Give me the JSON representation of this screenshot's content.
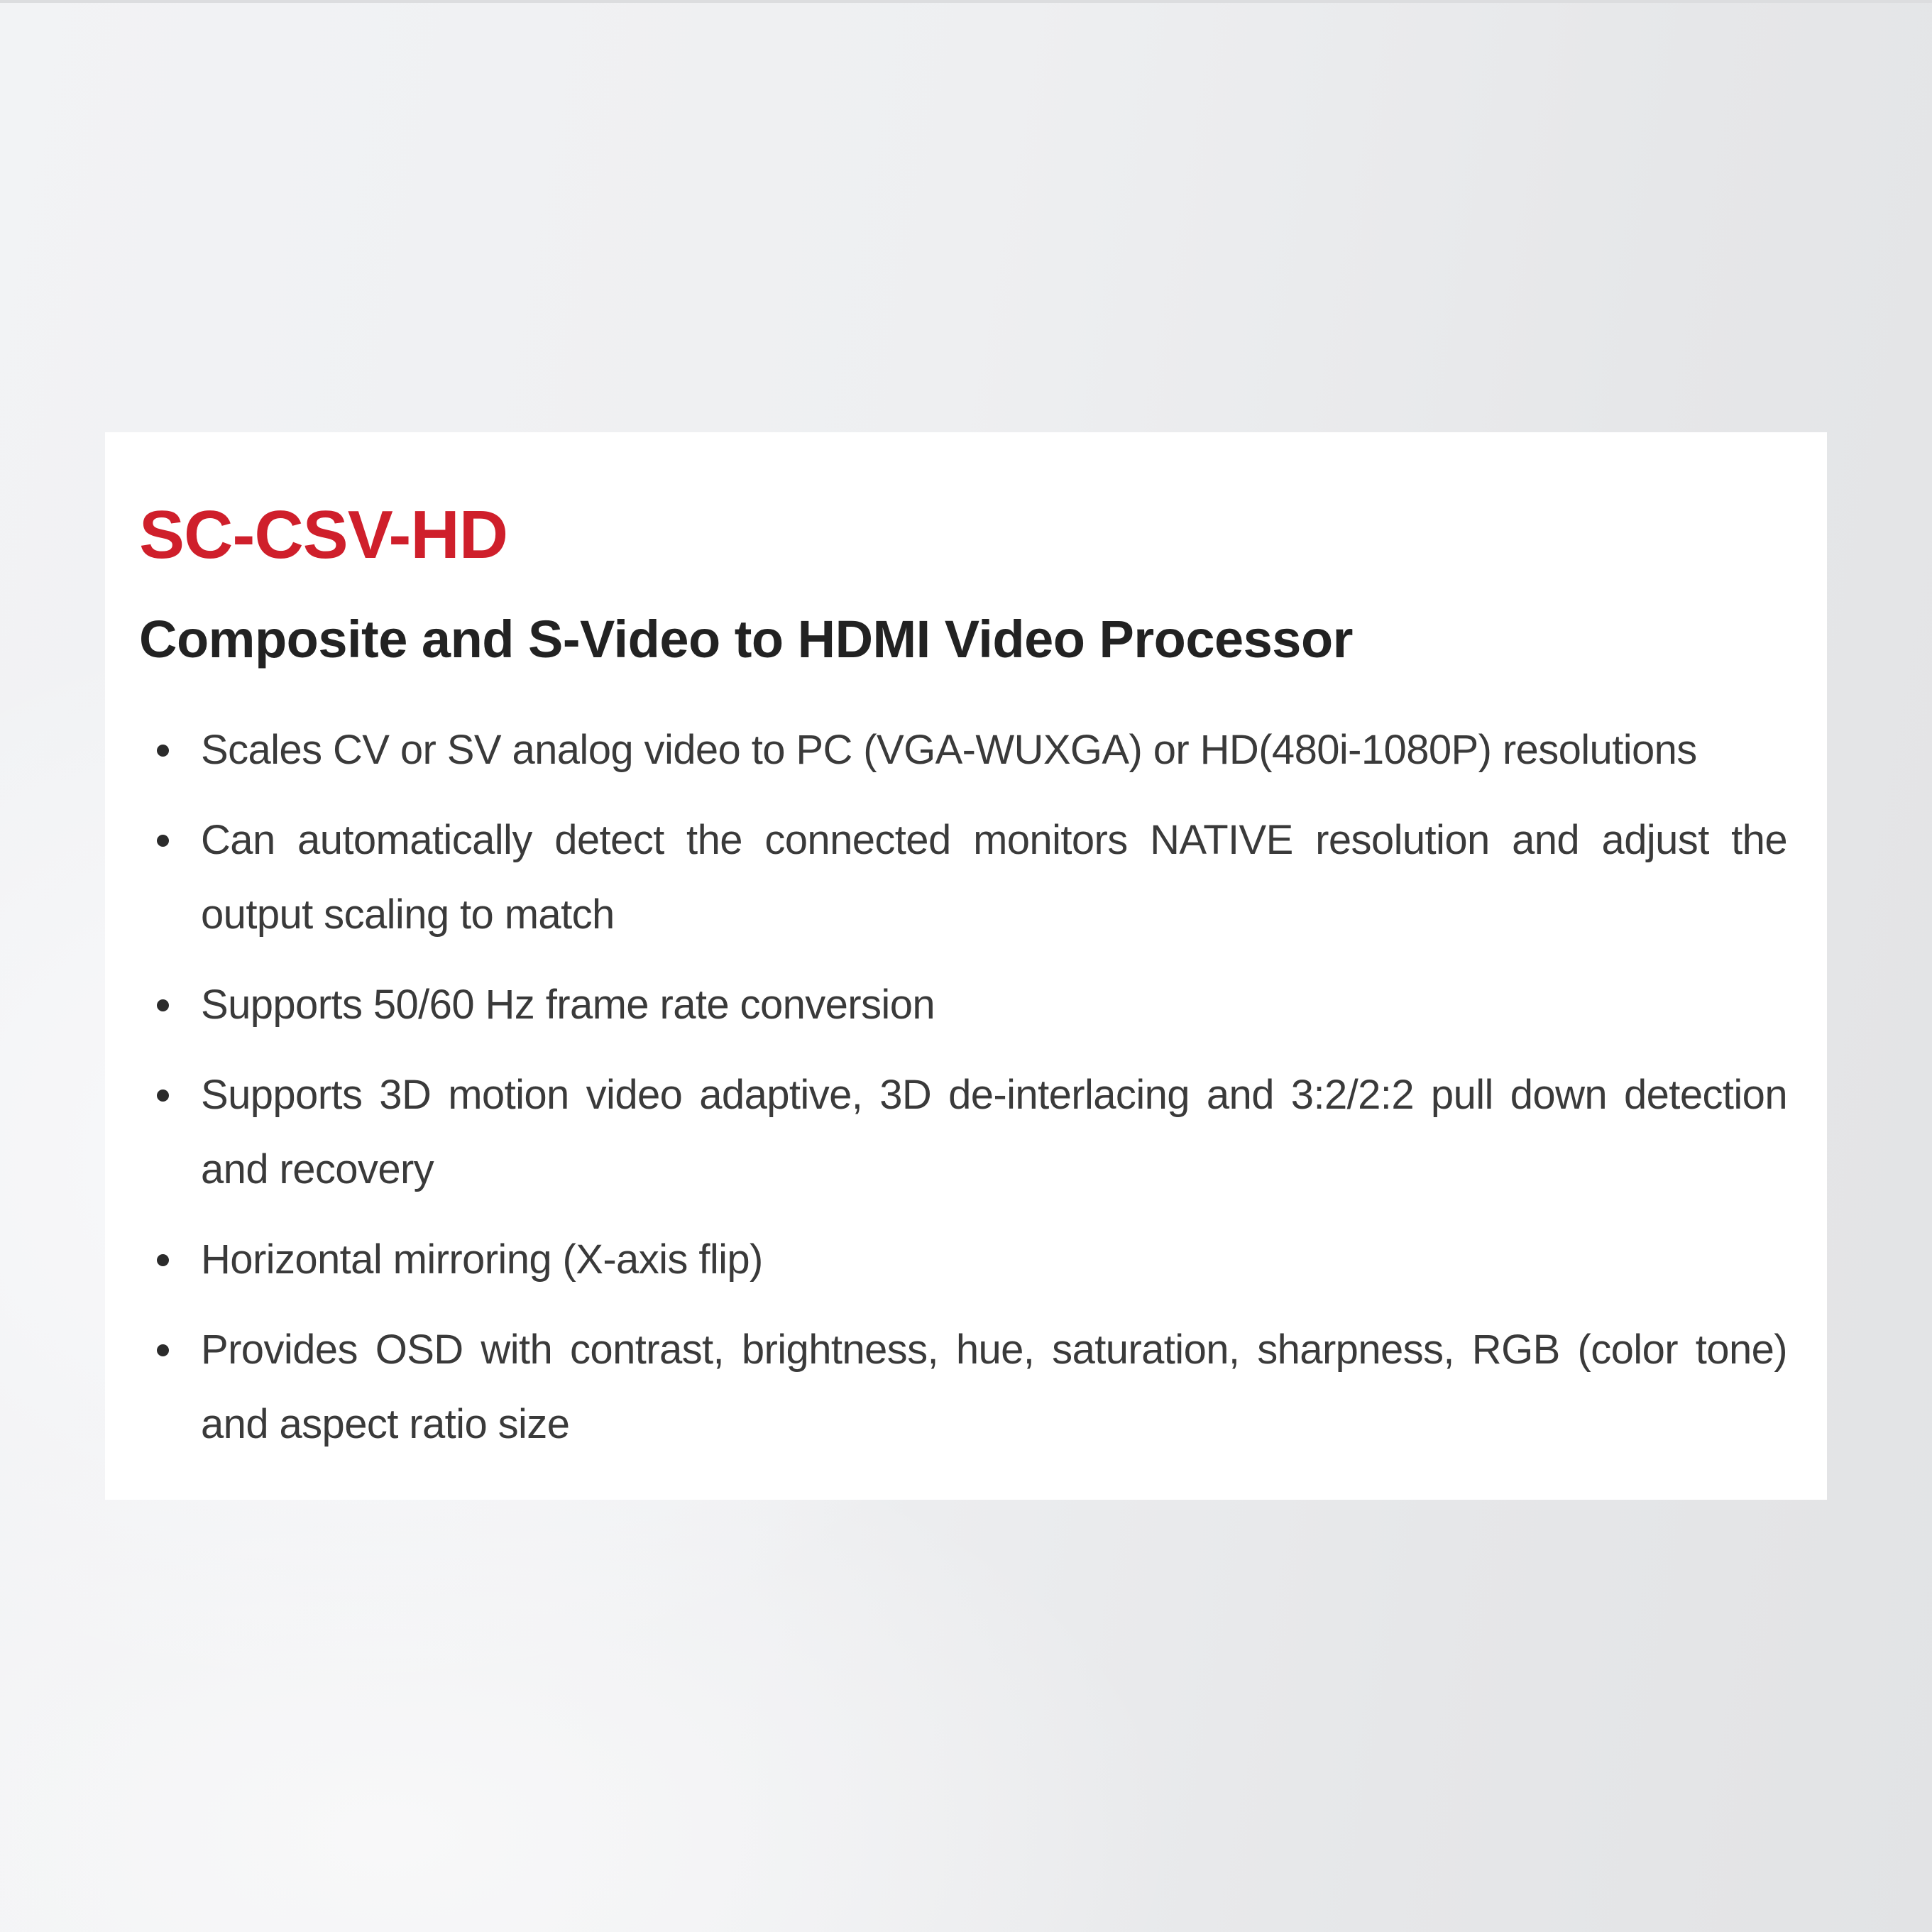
{
  "colors": {
    "accent_red": "#cf1f2b",
    "heading_dark": "#222222",
    "body_text": "#3a3a3a",
    "bullet": "#2b2b2b",
    "card_background": "#ffffff"
  },
  "product": {
    "code": "SC-CSV-HD",
    "subtitle": "Composite and S-Video to HDMI Video Processor"
  },
  "features": [
    {
      "icon": "bullet-dot",
      "text": "Scales CV or SV analog video to PC (VGA-WUXGA) or HD(480i-1080P) resolutions"
    },
    {
      "icon": "bullet-dot",
      "text": "Can automatically detect the connected monitors NATIVE resolution and adjust the output scaling to match"
    },
    {
      "icon": "bullet-dot",
      "text": "Supports 50/60 Hz frame rate conversion"
    },
    {
      "icon": "bullet-dot",
      "text": "Supports 3D motion video adaptive, 3D de-interlacing and 3:2/2:2 pull down detection and recovery"
    },
    {
      "icon": "bullet-dot",
      "text": "Horizontal mirroring (X-axis flip)"
    },
    {
      "icon": "bullet-dot",
      "text": "Provides OSD with contrast, brightness, hue, saturation, sharpness, RGB (color tone) and aspect ratio size"
    }
  ]
}
